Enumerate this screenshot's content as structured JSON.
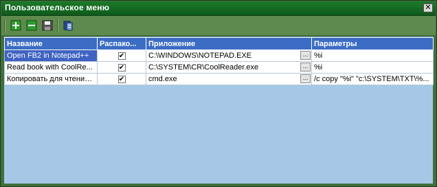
{
  "window": {
    "title": "Пользовательское меню",
    "close_glyph": "✕"
  },
  "toolbar": {
    "buttons": [
      {
        "name": "add-icon",
        "color": "#2e9b2e"
      },
      {
        "name": "remove-icon",
        "color": "#2e9b2e"
      },
      {
        "name": "save-icon",
        "color": "#444444"
      },
      {
        "name": "properties-icon",
        "color": "#2a4f8f"
      }
    ]
  },
  "grid": {
    "columns": [
      "Название",
      "Распако...",
      "Приложение",
      "Параметры"
    ],
    "rows": [
      {
        "name": "Open FB2 in Notepad++",
        "checked": true,
        "app": "C:\\WINDOWS\\NOTEPAD.EXE",
        "params": "%i",
        "selected": true
      },
      {
        "name": "Read book with CoolRe...",
        "checked": true,
        "app": "C:\\SYSTEM\\CR\\CoolReader.exe",
        "params": "%i",
        "selected": false
      },
      {
        "name": "Копировать для чтения...",
        "checked": true,
        "app": "cmd.exe",
        "params": "/c copy \"%i\" \"c:\\SYSTEM\\TXT\\%...",
        "selected": false
      }
    ],
    "check_glyph": "✔",
    "browse_glyph": "..."
  },
  "colors": {
    "header_bg": "#3c6dc4",
    "content_bg": "#a6c8e6",
    "selection_bg": "#3f63c2"
  }
}
